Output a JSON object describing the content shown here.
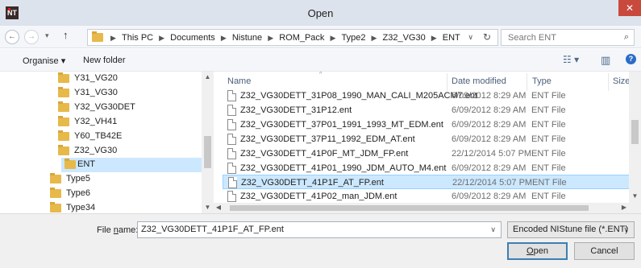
{
  "window": {
    "title": "Open",
    "close_glyph": "✕",
    "app_icon_label": "NT"
  },
  "nav": {
    "back_glyph": "←",
    "forward_glyph": "→",
    "recent_glyph": "▾",
    "up_glyph": "↑",
    "breadcrumb": [
      "This PC",
      "Documents",
      "Nistune",
      "ROM_Pack",
      "Type2",
      "Z32_VG30",
      "ENT"
    ],
    "sep_glyph": "▶",
    "dropdown_glyph": "∨",
    "refresh_glyph": "↻",
    "search_placeholder": "Search ENT",
    "search_icon": "⌕"
  },
  "toolbar": {
    "organise": "Organise ▾",
    "new_folder": "New folder",
    "views_icon": "☷ ▾",
    "pane_icon": "▥",
    "help_icon": "?"
  },
  "tree": {
    "items": [
      {
        "label": "Y31_VG20",
        "indent": 2
      },
      {
        "label": "Y31_VG30",
        "indent": 2
      },
      {
        "label": "Y32_VG30DET",
        "indent": 2
      },
      {
        "label": "Y32_VH41",
        "indent": 2
      },
      {
        "label": "Y60_TB42E",
        "indent": 2
      },
      {
        "label": "Z32_VG30",
        "indent": 2
      },
      {
        "label": "ENT",
        "indent": 3,
        "selected": true
      },
      {
        "label": "Type5",
        "indent": 1
      },
      {
        "label": "Type6",
        "indent": 1
      },
      {
        "label": "Type34",
        "indent": 1
      }
    ]
  },
  "filelist": {
    "columns": [
      "Name",
      "Date modified",
      "Type",
      "Size"
    ],
    "rows": [
      {
        "name": "Z32_VG30DETT_31P08_1990_MAN_CALI_M205ACM7.ent",
        "date": "6/09/2012 8:29 AM",
        "type": "ENT File"
      },
      {
        "name": "Z32_VG30DETT_31P12.ent",
        "date": "6/09/2012 8:29 AM",
        "type": "ENT File"
      },
      {
        "name": "Z32_VG30DETT_37P01_1991_1993_MT_EDM.ent",
        "date": "6/09/2012 8:29 AM",
        "type": "ENT File"
      },
      {
        "name": "Z32_VG30DETT_37P11_1992_EDM_AT.ent",
        "date": "6/09/2012 8:29 AM",
        "type": "ENT File"
      },
      {
        "name": "Z32_VG30DETT_41P0F_MT_JDM_FP.ent",
        "date": "22/12/2014 5:07 PM",
        "type": "ENT File"
      },
      {
        "name": "Z32_VG30DETT_41P01_1990_JDM_AUTO_M4.ent",
        "date": "6/09/2012 8:29 AM",
        "type": "ENT File"
      },
      {
        "name": "Z32_VG30DETT_41P1F_AT_FP.ent",
        "date": "22/12/2014 5:07 PM",
        "type": "ENT File",
        "selected": true
      },
      {
        "name": "Z32_VG30DETT_41P02_man_JDM.ent",
        "date": "6/09/2012 8:29 AM",
        "type": "ENT File"
      }
    ]
  },
  "bottom": {
    "filename_label_pre": "File ",
    "filename_label_u": "n",
    "filename_label_post": "ame:",
    "filename_value": "Z32_VG30DETT_41P1F_AT_FP.ent",
    "filetype_value": "Encoded NIStune file (*.ENT)",
    "open_u": "O",
    "open_rest": "pen",
    "cancel": "Cancel"
  },
  "colors": {
    "titlebar": "#dde3ec",
    "selection": "#cce8ff",
    "close": "#c94a3c",
    "folder": "#e6b94a"
  }
}
